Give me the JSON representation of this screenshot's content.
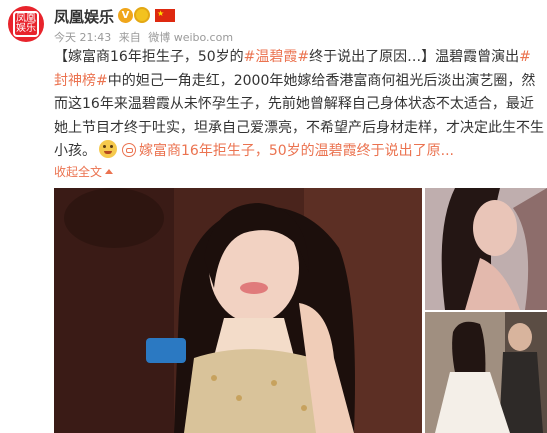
{
  "post": {
    "avatar_text": "凤凰娱乐",
    "username": "凤凰娱乐",
    "verified_glyph": "V",
    "time": "今天 21:43",
    "source_prefix": "来自",
    "source": "微博 weibo.com",
    "text": {
      "p1": "【嫁富商16年拒生子，50岁的",
      "tag1": "#温碧霞#",
      "p2": "终于说出了原因…】温碧霞曾演出",
      "tag2": "#封神榜#",
      "p3": "中的妲己一角走红，2000年她嫁给香港富商何祖光后淡出演艺圈，然而这16年来温碧霞从未怀孕生子，先前她曾解释自己身体状态不太适合，最近她上节目才终于吐实，坦承自己爱漂亮，不希望产后身材走样，才决定此生不生小孩。",
      "link": "嫁富商16年拒生子，50岁的温碧霞终于说出了原..."
    },
    "collapse_label": "收起全文"
  },
  "icons": {
    "verified": "verified-badge-icon",
    "medal": "medal-icon",
    "flag": "china-flag-icon",
    "emoji": "drooling-face-emoji-icon",
    "link": "link-icon",
    "collapse": "caret-up-icon"
  },
  "colors": {
    "link": "#eb7350",
    "avatar_bg": "#e8242c",
    "meta": "#9a9a9a"
  }
}
